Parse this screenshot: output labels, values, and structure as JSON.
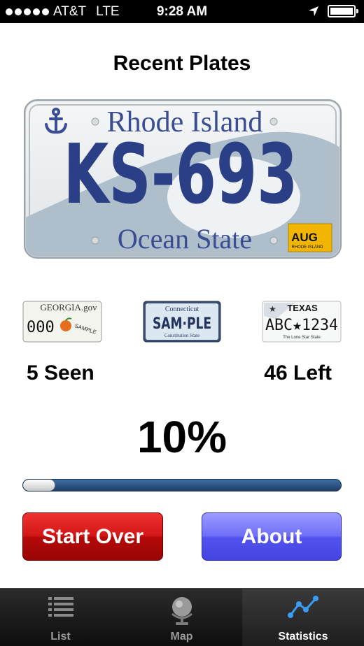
{
  "status": {
    "carrier": "AT&T",
    "network": "LTE",
    "time": "9:28 AM"
  },
  "title": "Recent Plates",
  "main_plate": {
    "state": "Rhode Island",
    "number": "KS-693",
    "slogan": "Ocean State",
    "sticker_month": "AUG",
    "sticker_state": "RHODE ISLAND"
  },
  "small_plates": [
    {
      "state": "GEORGIA.gov",
      "number": "000",
      "note": "SAMPLE"
    },
    {
      "state": "Connecticut",
      "number": "SAM·PLE",
      "slogan": "Constitution State"
    },
    {
      "state": "TEXAS",
      "number": "ABC★1234",
      "slogan": "The Lone Star State"
    }
  ],
  "stats": {
    "seen": "5 Seen",
    "left": "46 Left",
    "percent": "10%",
    "progress": 0.1
  },
  "buttons": {
    "start_over": "Start Over",
    "about": "About"
  },
  "colors": {
    "start_over": "#d31616",
    "about": "#6f6ff8",
    "progress_track": "#2f5a8a",
    "plate_blue": "#2a3f86"
  },
  "tabs": [
    {
      "label": "List",
      "icon": "list-icon",
      "active": false
    },
    {
      "label": "Map",
      "icon": "globe-icon",
      "active": false
    },
    {
      "label": "Statistics",
      "icon": "statistics-icon",
      "active": true
    }
  ]
}
